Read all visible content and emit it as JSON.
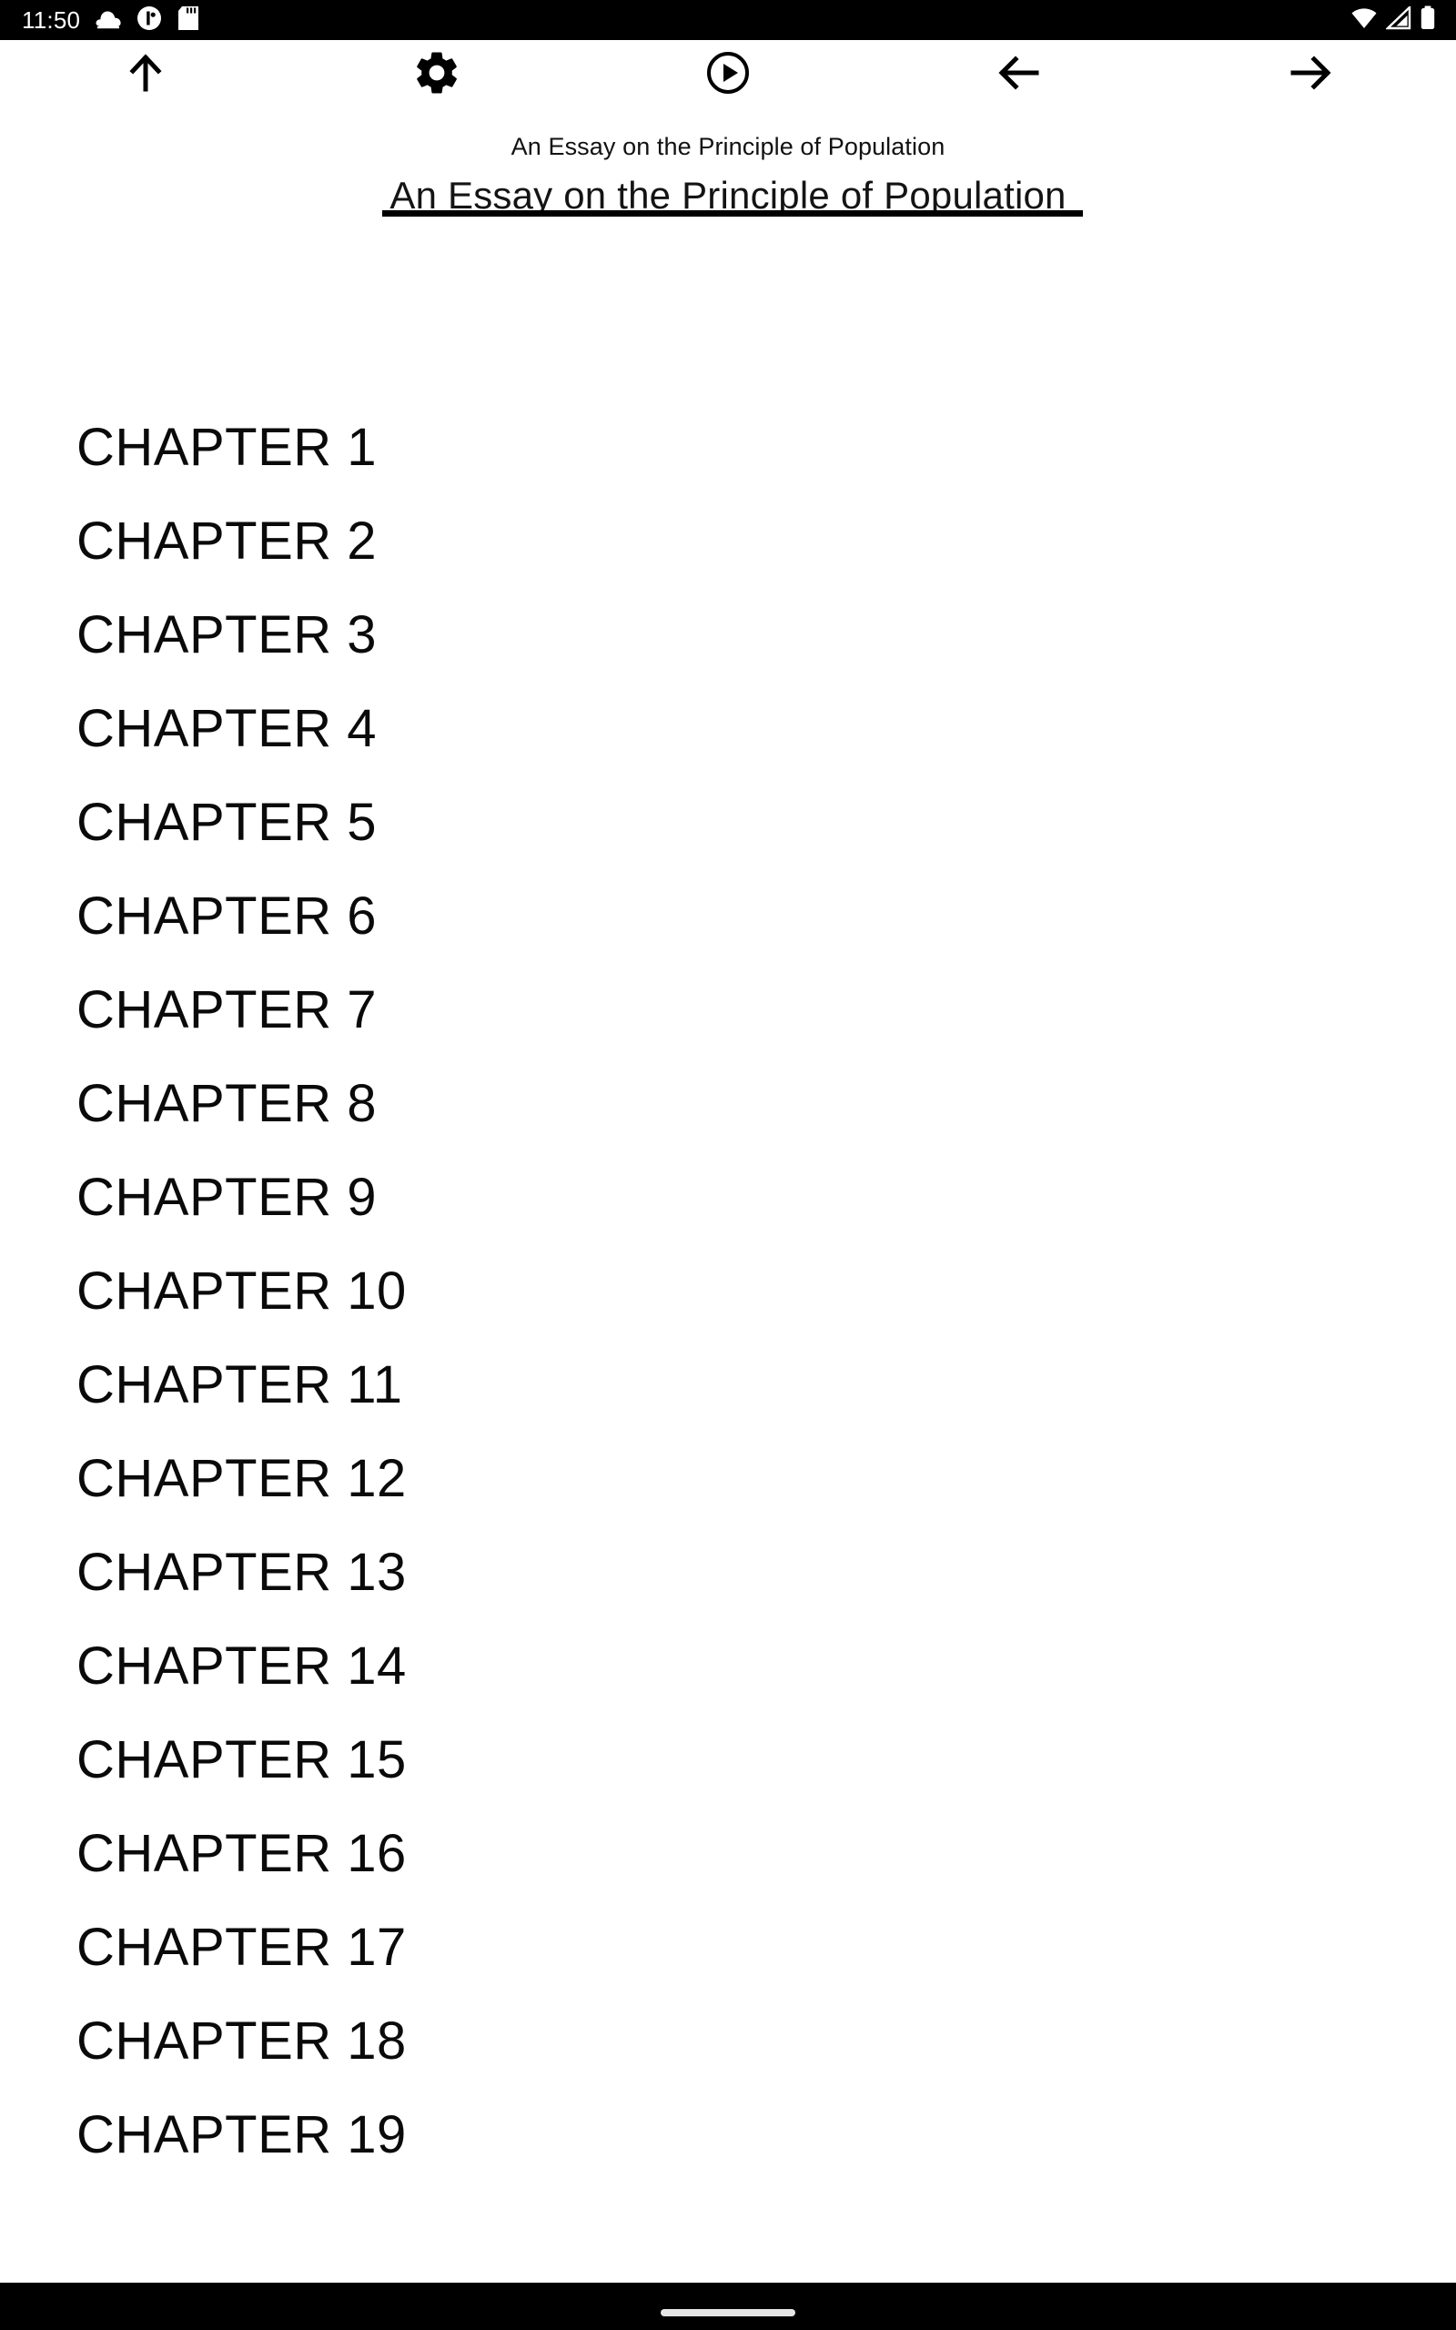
{
  "status_bar": {
    "clock": "11:50",
    "left_icons": [
      {
        "name": "cloud-icon",
        "glyph": "cloud"
      },
      {
        "name": "app-circle-icon",
        "glyph": "circle-badge"
      },
      {
        "name": "sd-card-icon",
        "glyph": "sd-card"
      }
    ],
    "right_icons": [
      {
        "name": "wifi-icon",
        "glyph": "wifi"
      },
      {
        "name": "cellular-signal-icon",
        "glyph": "signal"
      },
      {
        "name": "battery-icon",
        "glyph": "battery"
      }
    ],
    "background_color": "#000000",
    "foreground_color": "#ffffff"
  },
  "toolbar": {
    "buttons": [
      {
        "name": "scroll-to-top-button",
        "icon": "arrow-up-icon",
        "label": "Scroll to top"
      },
      {
        "name": "settings-button",
        "icon": "gear-icon",
        "label": "Settings"
      },
      {
        "name": "text-to-speech-button",
        "icon": "play-circle-icon",
        "label": "Read aloud"
      },
      {
        "name": "back-button",
        "icon": "arrow-left-icon",
        "label": "Back"
      },
      {
        "name": "forward-button",
        "icon": "arrow-right-icon",
        "label": "Forward"
      }
    ]
  },
  "book": {
    "title_small": "An Essay on the Principle of Population",
    "title_large": "An Essay on the Principle of Population"
  },
  "chapters": [
    {
      "label": "CHAPTER 1"
    },
    {
      "label": "CHAPTER 2"
    },
    {
      "label": "CHAPTER 3"
    },
    {
      "label": "CHAPTER 4"
    },
    {
      "label": "CHAPTER 5"
    },
    {
      "label": "CHAPTER 6"
    },
    {
      "label": "CHAPTER 7"
    },
    {
      "label": "CHAPTER 8"
    },
    {
      "label": "CHAPTER 9"
    },
    {
      "label": "CHAPTER 10"
    },
    {
      "label": "CHAPTER 11"
    },
    {
      "label": "CHAPTER 12"
    },
    {
      "label": "CHAPTER 13"
    },
    {
      "label": "CHAPTER 14"
    },
    {
      "label": "CHAPTER 15"
    },
    {
      "label": "CHAPTER 16"
    },
    {
      "label": "CHAPTER 17"
    },
    {
      "label": "CHAPTER 18"
    },
    {
      "label": "CHAPTER 19"
    }
  ],
  "nav_bar": {
    "gesture_pill": "home-gesture-pill",
    "background_color": "#000000",
    "pill_color": "#e6e6e6"
  },
  "colors": {
    "page_background": "#ffffff",
    "text": "#0a0a0a",
    "rule": "#000000"
  }
}
